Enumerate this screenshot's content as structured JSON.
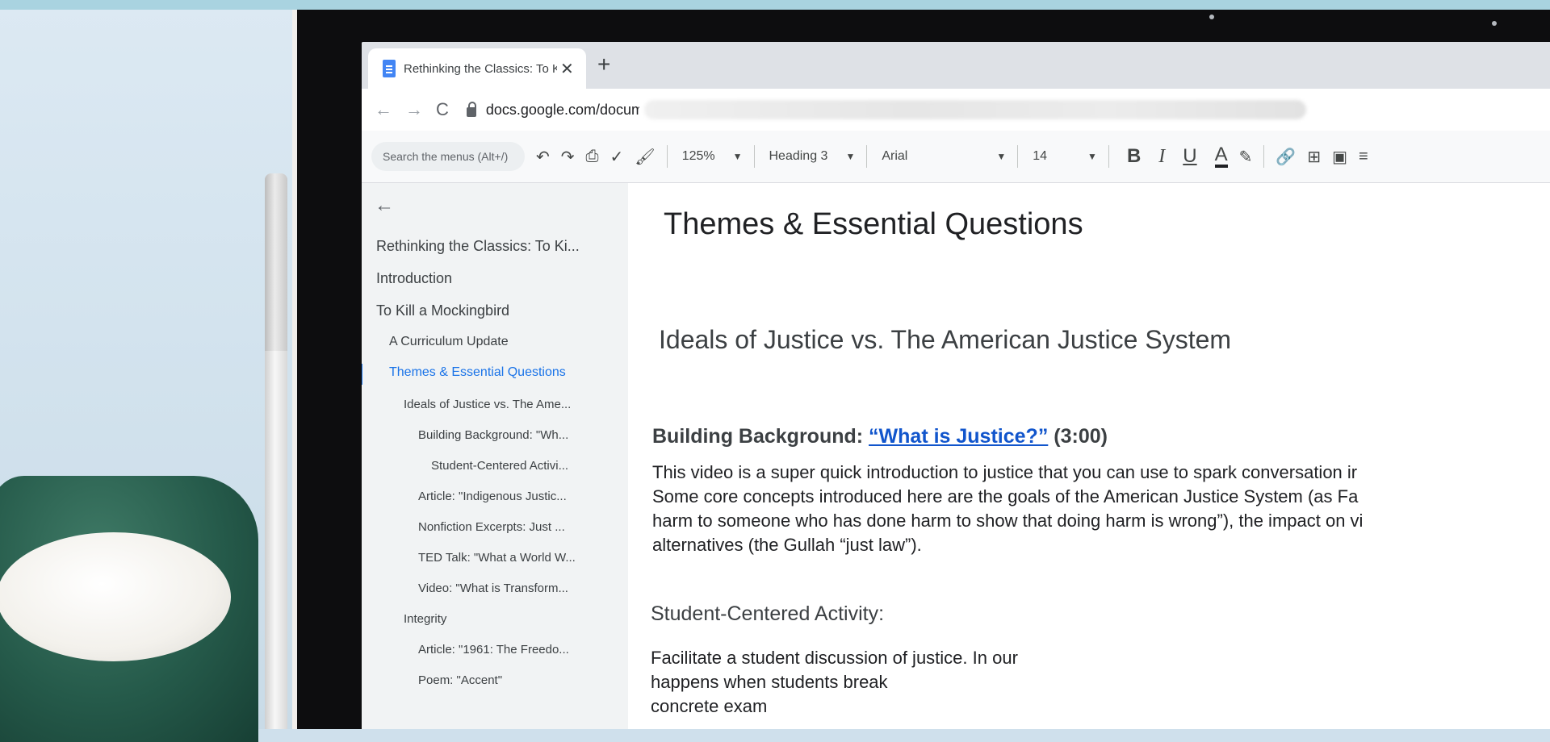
{
  "browser": {
    "tab_title": "Rethinking the Classics: To Kill a",
    "close_glyph": "✕",
    "new_tab_glyph": "+",
    "back_glyph": "←",
    "forward_glyph": "→",
    "reload_glyph": "C",
    "url": "docs.google.com/docume"
  },
  "toolbar": {
    "menu_search_placeholder": "Search the menus (Alt+/)",
    "zoom": "125%",
    "style": "Heading 3",
    "font": "Arial",
    "font_size": "14",
    "bold": "B",
    "italic": "I",
    "underline": "U",
    "text_color": "A"
  },
  "outline": {
    "back_glyph": "←",
    "items": [
      "Rethinking the Classics: To Ki...",
      "Introduction",
      "To Kill a Mockingbird",
      "A Curriculum Update",
      "Themes & Essential Questions",
      "Ideals of Justice vs. The Ame...",
      "Building Background: \"Wh...",
      "Student-Centered Activi...",
      "Article: \"Indigenous Justic...",
      "Nonfiction Excerpts: Just ...",
      "TED Talk: \"What a World W...",
      "Video: \"What is Transform...",
      "Integrity",
      "Article: \"1961: The Freedo...",
      "Poem: \"Accent\""
    ]
  },
  "document": {
    "title": "Themes & Essential Questions",
    "subtitle": "Ideals of Justice vs. The American Justice System",
    "section_label": "Building Background: ",
    "section_link": "“What is Justice?”",
    "section_duration": " (3:00)",
    "para_lines": [
      "This video is a super quick introduction to justice that you can use to spark conversation ir",
      "Some core concepts introduced here are the goals of the American Justice System (as Fa",
      "harm to someone who has done harm to show that doing harm is wrong”), the impact on vi",
      "alternatives (the Gullah “just law”)."
    ],
    "activity_heading": "Student-Centered Activity:",
    "activity_lines": [
      "Facilitate a student discussion of justice. In our",
      "happens when students break",
      "concrete exam"
    ]
  },
  "colors": {
    "link": "#1155cc",
    "outline_active": "#1a73e8",
    "docs_blue": "#4285f4"
  }
}
